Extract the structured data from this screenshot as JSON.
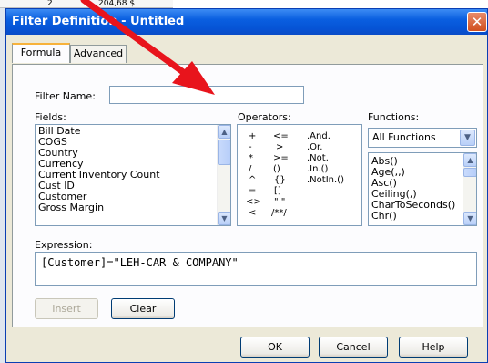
{
  "background": {
    "row_number": "2",
    "row_value": "204,68 $"
  },
  "dialog": {
    "title": "Filter Definition - Untitled",
    "close_glyph": "✕",
    "tabs": [
      {
        "label": "Formula",
        "active": true
      },
      {
        "label": "Advanced",
        "active": false
      }
    ],
    "filter_name": {
      "label": "Filter Name:",
      "value": ""
    },
    "fields": {
      "label": "Fields:",
      "items": [
        "Bill Date",
        "COGS",
        "Country",
        "Currency",
        "Current Inventory Count",
        "Cust ID",
        "Customer",
        "Gross Margin"
      ]
    },
    "operators": {
      "label": "Operators:",
      "col1": [
        "+",
        "-",
        "*",
        "/",
        "^",
        "=",
        "<>",
        "<"
      ],
      "col2": [
        "<=",
        ">",
        ">=",
        "()",
        "{}",
        "[]",
        "\" \"",
        "/**/"
      ],
      "col3": [
        ".And.",
        ".Or.",
        ".Not.",
        ".In.()",
        ".NotIn.()"
      ]
    },
    "functions": {
      "label": "Functions:",
      "selected": "All Functions",
      "items": [
        "Abs()",
        "Age(,,)",
        "Asc()",
        "Ceiling(,)",
        "CharToSeconds()",
        "Chr()"
      ]
    },
    "expression": {
      "label": "Expression:",
      "value": "[Customer]=\"LEH-CAR & COMPANY\""
    },
    "buttons": {
      "insert": "Insert",
      "clear": "Clear",
      "ok": "OK",
      "cancel": "Cancel",
      "help": "Help"
    }
  },
  "colors": {
    "titlebar": "#0a5fe0",
    "dialog_face": "#ece9d8",
    "annotation_arrow": "#e8141c",
    "tab_highlight": "#f7b23b"
  }
}
